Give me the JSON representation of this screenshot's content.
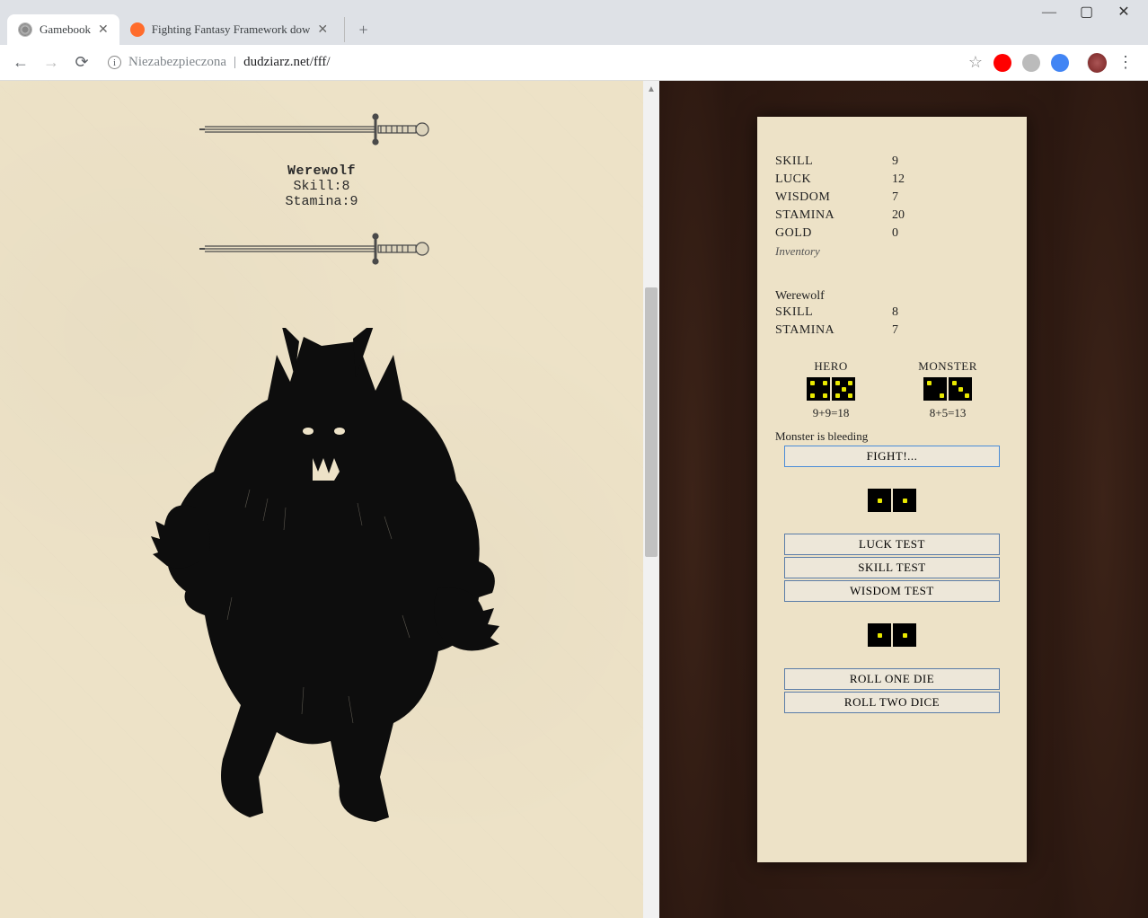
{
  "browser": {
    "tabs": [
      {
        "title": "Gamebook",
        "active": true
      },
      {
        "title": "Fighting Fantasy Framework dow",
        "active": false
      }
    ],
    "address_security": "Niezabezpieczona",
    "address_url": "dudziarz.net/fff/"
  },
  "page": {
    "monster_name": "Werewolf",
    "monster_skill_label": "Skill:",
    "monster_skill_value": "8",
    "monster_stamina_label": "Stamina:",
    "monster_stamina_value": "9"
  },
  "hero_stats": {
    "skill_label": "SKILL",
    "skill_value": "9",
    "luck_label": "LUCK",
    "luck_value": "12",
    "wisdom_label": "WISDOM",
    "wisdom_value": "7",
    "stamina_label": "STAMINA",
    "stamina_value": "20",
    "gold_label": "GOLD",
    "gold_value": "0",
    "inventory_label": "Inventory"
  },
  "enemy_stats": {
    "name": "Werewolf",
    "skill_label": "SKILL",
    "skill_value": "8",
    "stamina_label": "STAMINA",
    "stamina_value": "7"
  },
  "combat": {
    "hero_label": "HERO",
    "monster_label": "MONSTER",
    "hero_calc": "9+9=18",
    "monster_calc": "8+5=13",
    "status": "Monster is bleeding",
    "fight_button": "FIGHT!..."
  },
  "tests": {
    "luck": "LUCK TEST",
    "skill": "SKILL TEST",
    "wisdom": "WISDOM TEST"
  },
  "rolls": {
    "one": "ROLL ONE DIE",
    "two": "ROLL TWO DICE"
  },
  "dice": {
    "hero": [
      4,
      5
    ],
    "monster": [
      2,
      3
    ],
    "test": [
      1,
      1
    ],
    "roll": [
      1,
      1
    ]
  }
}
